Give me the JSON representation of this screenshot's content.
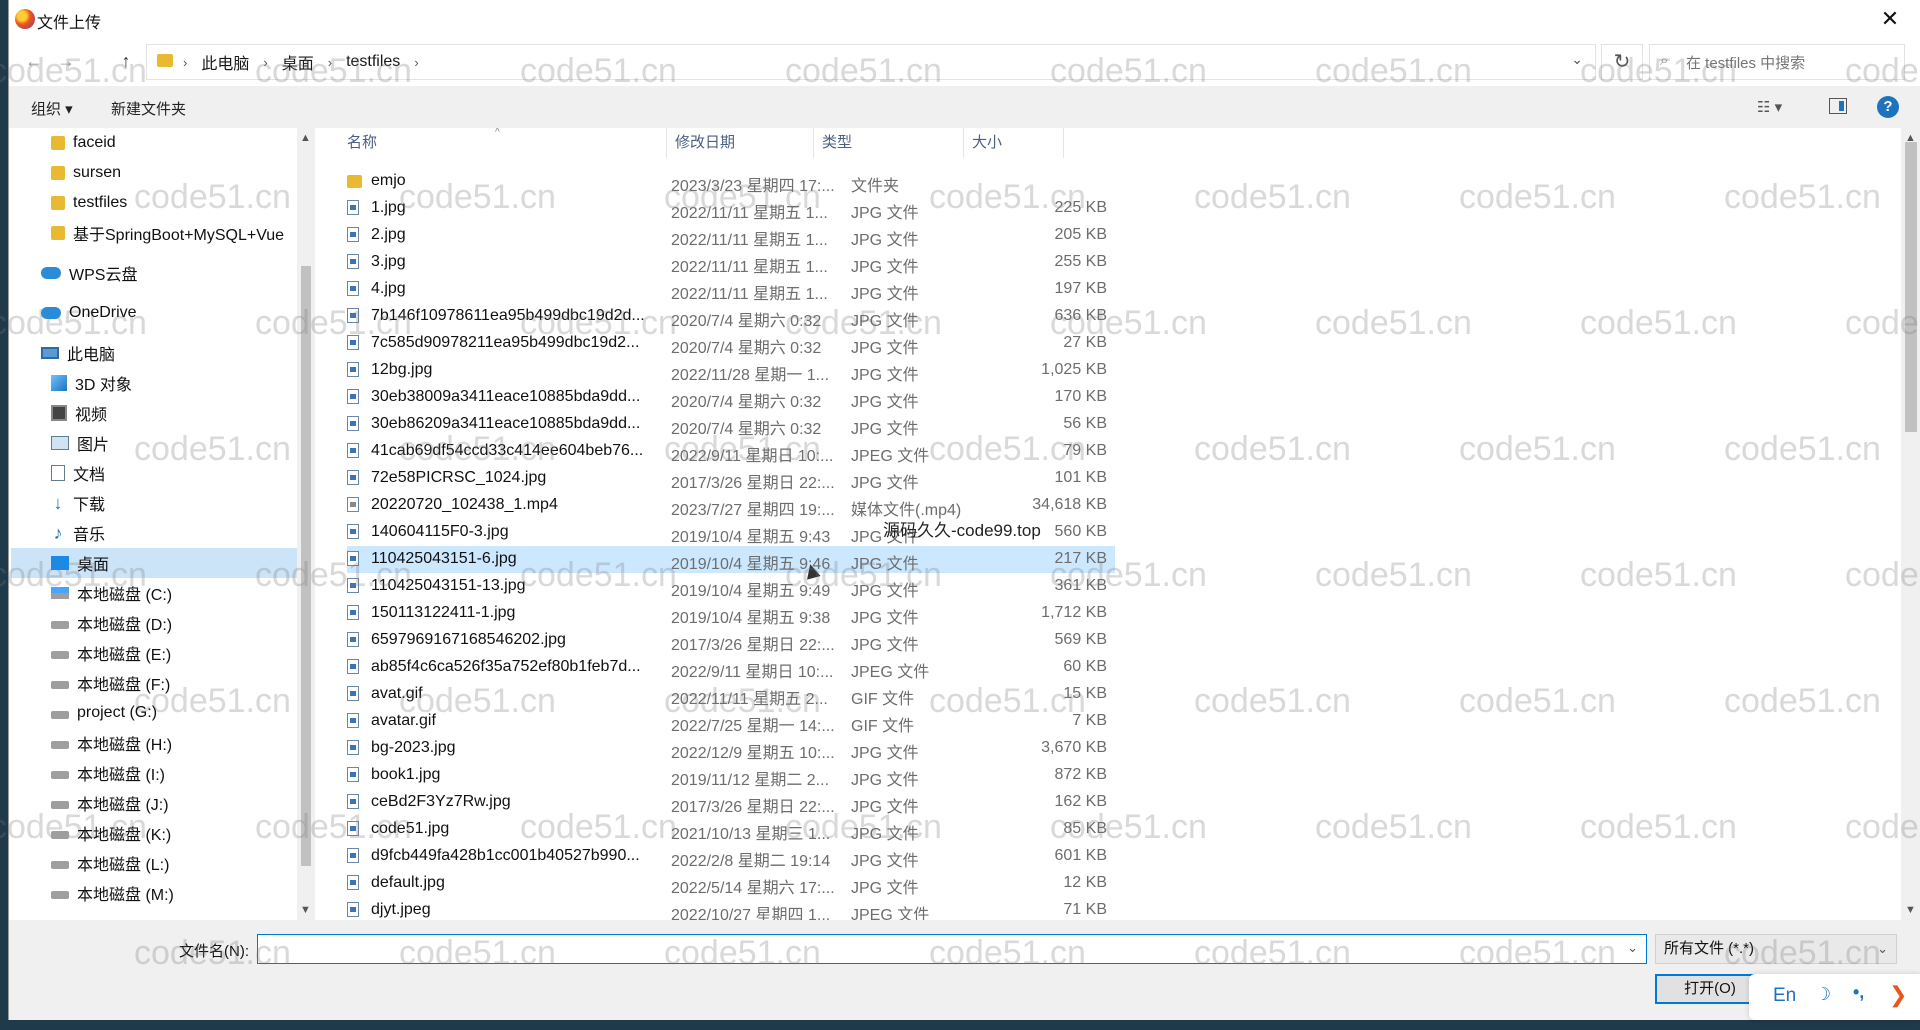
{
  "window": {
    "title": "文件上传",
    "close_glyph": "✕"
  },
  "address": {
    "crumbs": [
      "此电脑",
      "桌面",
      "testfiles"
    ],
    "search_placeholder": "在 testfiles 中搜索"
  },
  "toolbar": {
    "organize": "组织 ▾",
    "new_folder": "新建文件夹",
    "view": "☷ ▾",
    "help": "?"
  },
  "sidebar": {
    "items": [
      {
        "label": "faceid",
        "icon": "folder-icon"
      },
      {
        "label": "sursen",
        "icon": "folder-icon"
      },
      {
        "label": "testfiles",
        "icon": "folder-icon"
      },
      {
        "label": "基于SpringBoot+MySQL+Vue",
        "icon": "folder-icon"
      },
      {
        "label": "WPS云盘",
        "icon": "cloud-icon"
      },
      {
        "label": "OneDrive",
        "icon": "cloud-icon"
      },
      {
        "label": "此电脑",
        "icon": "computer-icon"
      },
      {
        "label": "3D 对象",
        "icon": "cube-icon"
      },
      {
        "label": "视频",
        "icon": "video-icon"
      },
      {
        "label": "图片",
        "icon": "picture-icon"
      },
      {
        "label": "文档",
        "icon": "document-icon"
      },
      {
        "label": "下载",
        "icon": "download-icon"
      },
      {
        "label": "音乐",
        "icon": "music-icon"
      },
      {
        "label": "桌面",
        "icon": "desktop-icon",
        "selected": true
      },
      {
        "label": "本地磁盘 (C:)",
        "icon": "drive-icon"
      },
      {
        "label": "本地磁盘 (D:)",
        "icon": "drive-icon"
      },
      {
        "label": "本地磁盘 (E:)",
        "icon": "drive-icon"
      },
      {
        "label": "本地磁盘 (F:)",
        "icon": "drive-icon"
      },
      {
        "label": "project (G:)",
        "icon": "drive-icon"
      },
      {
        "label": "本地磁盘 (H:)",
        "icon": "drive-icon"
      },
      {
        "label": "本地磁盘 (I:)",
        "icon": "drive-icon"
      },
      {
        "label": "本地磁盘 (J:)",
        "icon": "drive-icon"
      },
      {
        "label": "本地磁盘 (K:)",
        "icon": "drive-icon"
      },
      {
        "label": "本地磁盘 (L:)",
        "icon": "drive-icon"
      },
      {
        "label": "本地磁盘 (M:)",
        "icon": "drive-icon"
      }
    ]
  },
  "columns": {
    "name": "名称",
    "date": "修改日期",
    "type": "类型",
    "size": "大小"
  },
  "files": [
    {
      "name": "emjo",
      "date": "2023/3/23 星期四 17:...",
      "type": "文件夹",
      "size": "",
      "kind": "folder"
    },
    {
      "name": "1.jpg",
      "date": "2022/11/11 星期五 1...",
      "type": "JPG 文件",
      "size": "225 KB"
    },
    {
      "name": "2.jpg",
      "date": "2022/11/11 星期五 1...",
      "type": "JPG 文件",
      "size": "205 KB"
    },
    {
      "name": "3.jpg",
      "date": "2022/11/11 星期五 1...",
      "type": "JPG 文件",
      "size": "255 KB"
    },
    {
      "name": "4.jpg",
      "date": "2022/11/11 星期五 1...",
      "type": "JPG 文件",
      "size": "197 KB"
    },
    {
      "name": "7b146f10978611ea95b499dbc19d2d...",
      "date": "2020/7/4 星期六 0:32",
      "type": "JPG 文件",
      "size": "636 KB"
    },
    {
      "name": "7c585d90978211ea95b499dbc19d2...",
      "date": "2020/7/4 星期六 0:32",
      "type": "JPG 文件",
      "size": "27 KB"
    },
    {
      "name": "12bg.jpg",
      "date": "2022/11/28 星期一 1...",
      "type": "JPG 文件",
      "size": "1,025 KB"
    },
    {
      "name": "30eb38009a3411eace10885bda9dd...",
      "date": "2020/7/4 星期六 0:32",
      "type": "JPG 文件",
      "size": "170 KB"
    },
    {
      "name": "30eb86209a3411eace10885bda9dd...",
      "date": "2020/7/4 星期六 0:32",
      "type": "JPG 文件",
      "size": "56 KB"
    },
    {
      "name": "41cab69df54ccd33c414ee604beb76...",
      "date": "2022/9/11 星期日 10:...",
      "type": "JPEG 文件",
      "size": "79 KB"
    },
    {
      "name": "72e58PICRSC_1024.jpg",
      "date": "2017/3/26 星期日 22:...",
      "type": "JPG 文件",
      "size": "101 KB"
    },
    {
      "name": "20220720_102438_1.mp4",
      "date": "2023/7/27 星期四 19:...",
      "type": "媒体文件(.mp4)",
      "size": "34,618 KB",
      "kind": "video"
    },
    {
      "name": "140604115F0-3.jpg",
      "date": "2019/10/4 星期五 9:43",
      "type": "JPG 文件",
      "size": "560 KB"
    },
    {
      "name": "110425043151-6.jpg",
      "date": "2019/10/4 星期五 9:46",
      "type": "JPG 文件",
      "size": "217 KB",
      "selected": true
    },
    {
      "name": "110425043151-13.jpg",
      "date": "2019/10/4 星期五 9:49",
      "type": "JPG 文件",
      "size": "361 KB"
    },
    {
      "name": "150113122411-1.jpg",
      "date": "2019/10/4 星期五 9:38",
      "type": "JPG 文件",
      "size": "1,712 KB"
    },
    {
      "name": "6597969167168546202.jpg",
      "date": "2017/3/26 星期日 22:...",
      "type": "JPG 文件",
      "size": "569 KB"
    },
    {
      "name": "ab85f4c6ca526f35a752ef80b1feb7d...",
      "date": "2022/9/11 星期日 10:...",
      "type": "JPEG 文件",
      "size": "60 KB"
    },
    {
      "name": "avat.gif",
      "date": "2022/11/11 星期五 2...",
      "type": "GIF 文件",
      "size": "15 KB"
    },
    {
      "name": "avatar.gif",
      "date": "2022/7/25 星期一 14:...",
      "type": "GIF 文件",
      "size": "7 KB"
    },
    {
      "name": "bg-2023.jpg",
      "date": "2022/12/9 星期五 10:...",
      "type": "JPG 文件",
      "size": "3,670 KB"
    },
    {
      "name": "book1.jpg",
      "date": "2019/11/12 星期二 2...",
      "type": "JPG 文件",
      "size": "872 KB"
    },
    {
      "name": "ceBd2F3Yz7Rw.jpg",
      "date": "2017/3/26 星期日 22:...",
      "type": "JPG 文件",
      "size": "162 KB"
    },
    {
      "name": "code51.jpg",
      "date": "2021/10/13 星期三 1...",
      "type": "JPG 文件",
      "size": "85 KB"
    },
    {
      "name": "d9fcb449fa428b1cc001b40527b990...",
      "date": "2022/2/8 星期二 19:14",
      "type": "JPG 文件",
      "size": "601 KB"
    },
    {
      "name": "default.jpg",
      "date": "2022/5/14 星期六 17:...",
      "type": "JPG 文件",
      "size": "12 KB"
    },
    {
      "name": "djyt.jpeg",
      "date": "2022/10/27 星期四 1...",
      "type": "JPEG 文件",
      "size": "71 KB"
    }
  ],
  "bottom": {
    "filename_label": "文件名(N):",
    "filename_value": "",
    "filter": "所有文件 (*.*)",
    "open_button": "打开(O)"
  },
  "ime": {
    "lang": "En",
    "moon": "☽",
    "punct": "•,",
    "more": "❯"
  },
  "overlay_text": "源码久久-code99.top",
  "watermark": "code51.cn"
}
